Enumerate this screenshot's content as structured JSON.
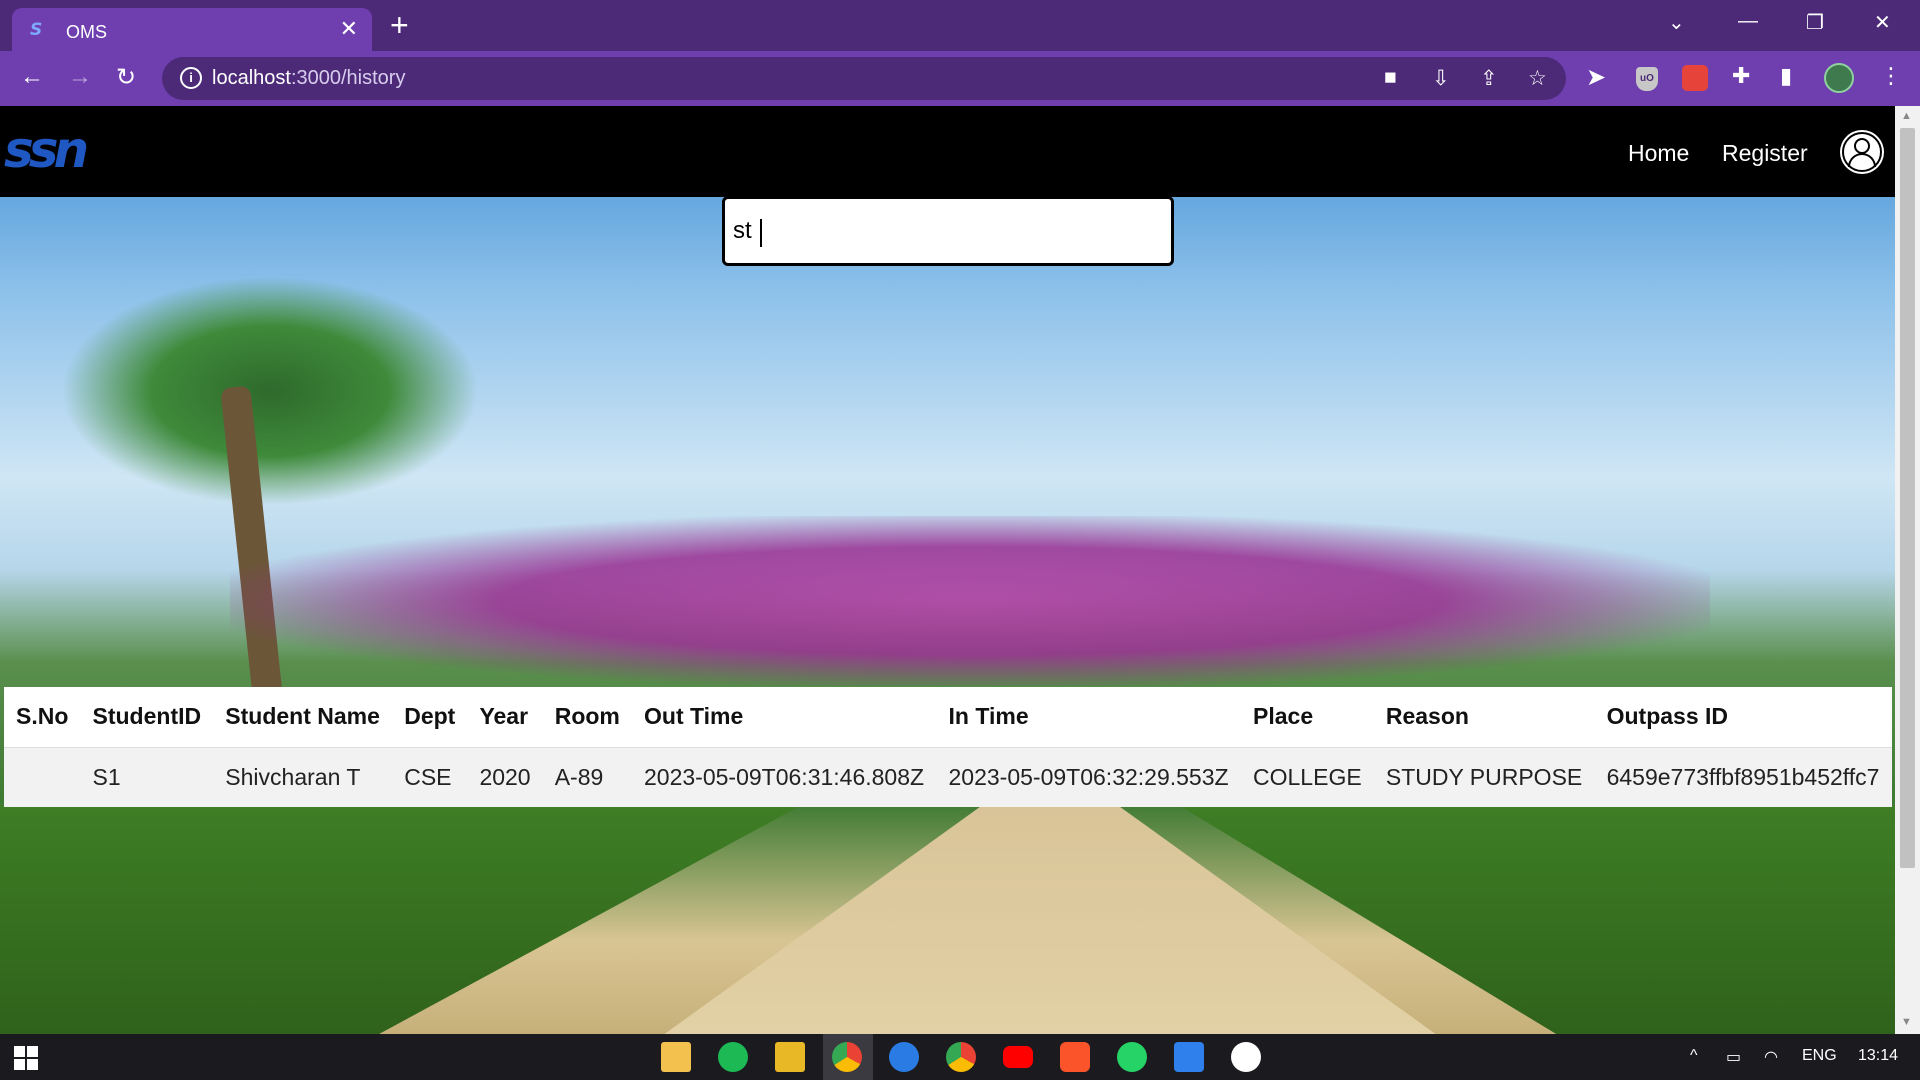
{
  "browser": {
    "tab_title": "OMS",
    "tab_favicon": "ssn-favicon",
    "url_host": "localhost",
    "url_path": ":3000/history",
    "icons": [
      "back-icon",
      "forward-icon",
      "reload-icon",
      "info-icon",
      "camera-icon",
      "install-icon",
      "share-icon",
      "star-icon",
      "cursor-extension-icon",
      "ublock-extension-icon",
      "red-extension-icon",
      "puzzle-icon",
      "sidepanel-icon",
      "profile-avatar",
      "kebab-menu-icon"
    ]
  },
  "app": {
    "logo": "ssn",
    "nav": {
      "home": "Home",
      "register": "Register"
    },
    "search": {
      "value": "st"
    }
  },
  "table": {
    "columns": [
      "S.No",
      "StudentID",
      "Student Name",
      "Dept",
      "Year",
      "Room",
      "Out Time",
      "In Time",
      "Place",
      "Reason",
      "Outpass ID"
    ],
    "rows": [
      {
        "sno": "",
        "student_id": "S1",
        "student_name": "Shivcharan T",
        "dept": "CSE",
        "year": "2020",
        "room": "A-89",
        "out_time": "2023-05-09T06:31:46.808Z",
        "in_time": "2023-05-09T06:32:29.553Z",
        "place": "COLLEGE",
        "reason": "STUDY PURPOSE",
        "outpass_id": "6459e773ffbf8951b452ffc7"
      }
    ]
  },
  "taskbar": {
    "apps": [
      "file-explorer-icon",
      "spotify-icon",
      "git-tool-icon",
      "chrome-icon",
      "spotify-alt-icon",
      "chrome-alt-icon",
      "youtube-icon",
      "brave-icon",
      "whatsapp-icon",
      "vscode-icon",
      "mongodb-compass-icon"
    ],
    "lang": "ENG",
    "time": "13:14"
  },
  "colors": {
    "browser_bg": "#4c2a78",
    "browser_tab": "#6f3fb0",
    "logo_blue": "#1f57c3",
    "taskbar": "#1b1b1f"
  }
}
